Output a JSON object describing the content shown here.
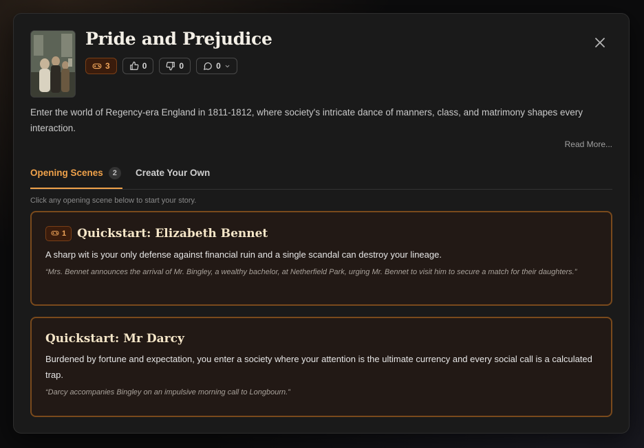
{
  "book": {
    "title": "Pride and Prejudice",
    "description": "Enter the world of Regency-era England in 1811-1812, where society's intricate dance of manners, class, and matrimony shapes every interaction.",
    "read_more": "Read More..."
  },
  "stats": {
    "plays": "3",
    "likes": "0",
    "dislikes": "0",
    "comments": "0"
  },
  "icons": {
    "cover": "book-cover-image",
    "plays": "gamepad-icon",
    "likes": "thumbs-up-icon",
    "dislikes": "thumbs-down-icon",
    "comments": "comment-icon",
    "comments_menu": "chevron-down-icon",
    "close": "close-icon"
  },
  "tabs": [
    {
      "label": "Opening Scenes",
      "count": "2",
      "active": true
    },
    {
      "label": "Create Your Own",
      "active": false
    }
  ],
  "hint": "Click any opening scene below to start your story.",
  "scenes": [
    {
      "plays": "1",
      "title": "Quickstart: Elizabeth Bennet",
      "description": "A sharp wit is your only defense against financial ruin and a single scandal can destroy your lineage.",
      "quote": "“Mrs. Bennet announces the arrival of Mr. Bingley, a wealthy bachelor, at Netherfield Park, urging Mr. Bennet to visit him to secure a match for their daughters.”"
    },
    {
      "title": "Quickstart: Mr Darcy",
      "description": "Burdened by fortune and expectation, you enter a society where your attention is the ultimate currency and every social call is a calculated trap.",
      "quote": "“Darcy accompanies Bingley on an impulsive morning call to Longbourn.”"
    }
  ],
  "colors": {
    "accent": "#f0a24a",
    "card_border": "#7a4a1c",
    "card_bg": "#221915",
    "modal_bg": "#1a1a1a"
  }
}
